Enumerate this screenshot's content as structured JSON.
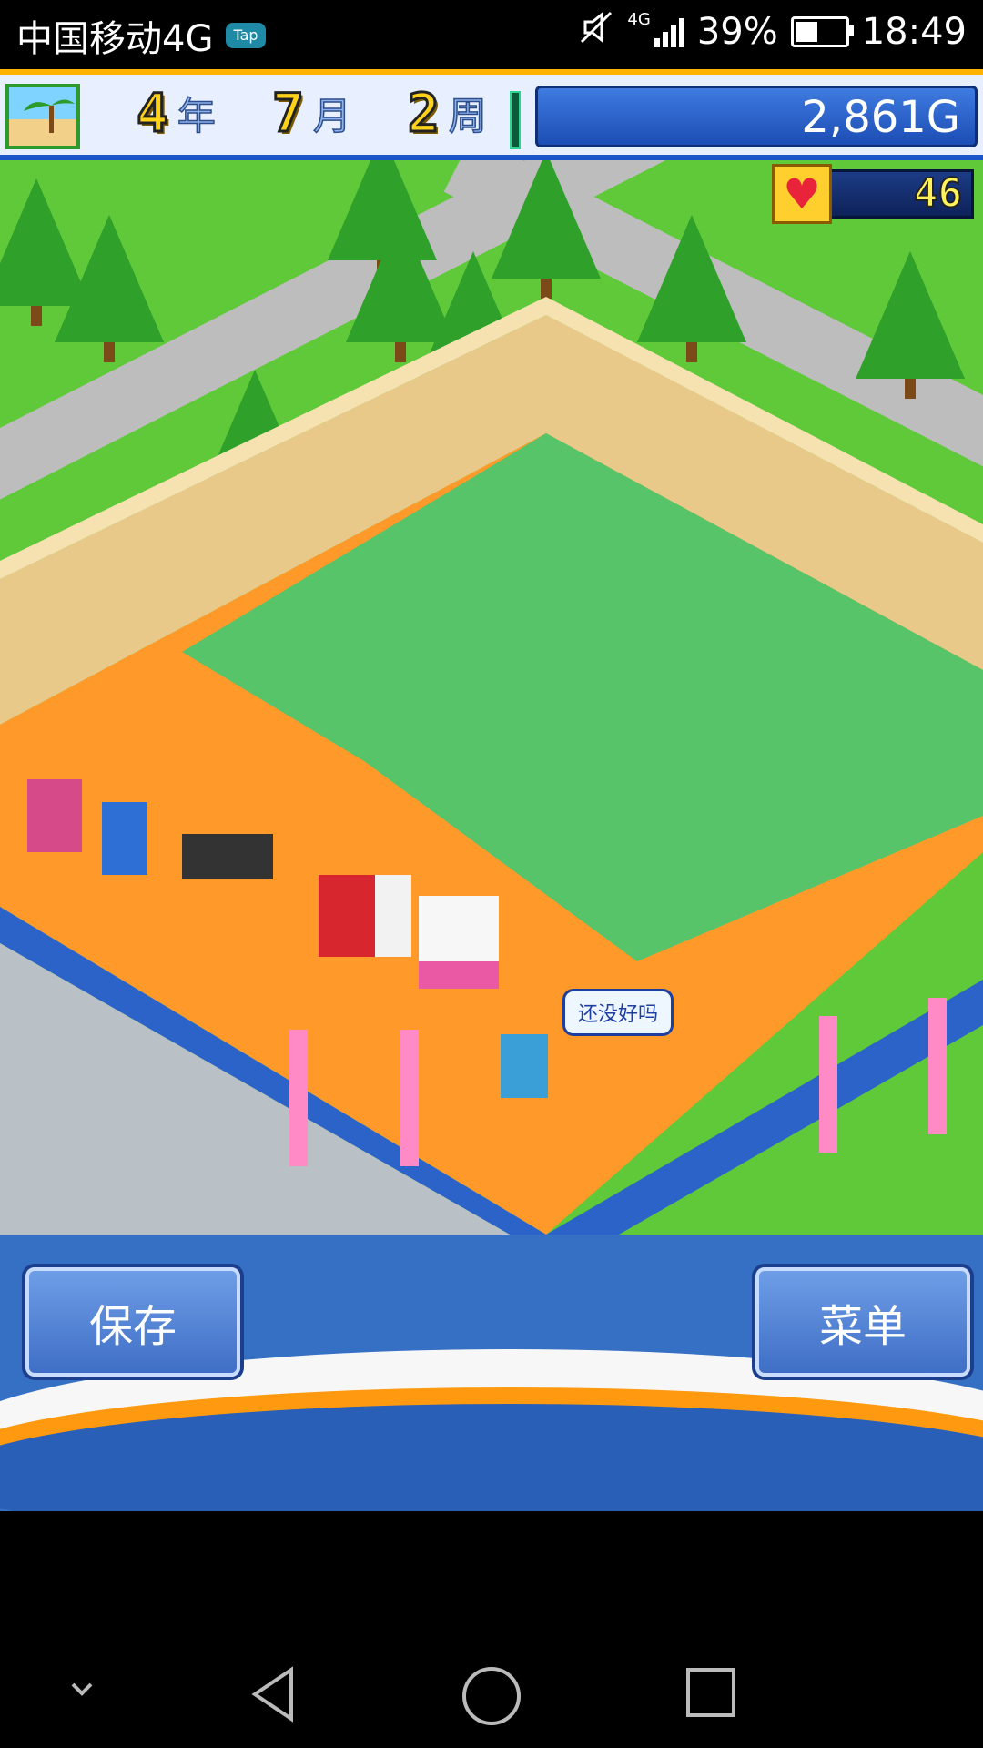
{
  "status_bar": {
    "carrier": "中国移动4G",
    "app_badge": "Tap",
    "network": "4G",
    "battery": "39%",
    "time": "18:49",
    "icons": [
      "mute-icon",
      "signal-icon",
      "battery-icon"
    ]
  },
  "hud": {
    "year": "4",
    "year_unit": "年",
    "month": "7",
    "month_unit": "月",
    "week": "2",
    "week_unit": "周",
    "money": "2,861G",
    "hearts": "46"
  },
  "scene": {
    "speech_bubble": "还没好吗"
  },
  "bottom_panel": {
    "save_label": "保存",
    "menu_label": "菜单"
  },
  "nav_bar": {
    "icons": [
      "chevron-down-icon",
      "back-triangle-icon",
      "home-circle-icon",
      "recents-square-icon"
    ]
  }
}
